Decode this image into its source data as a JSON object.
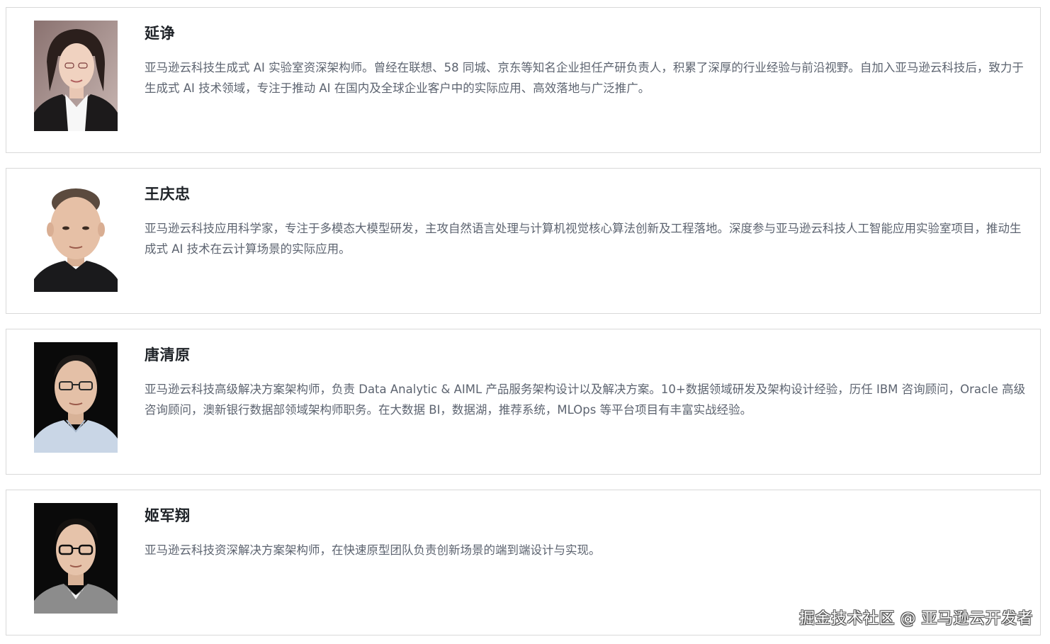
{
  "profiles": [
    {
      "name": "延诤",
      "bio": "亚马逊云科技生成式 AI 实验室资深架构师。曾经在联想、58 同城、京东等知名企业担任产研负责人，积累了深厚的行业经验与前沿视野。自加入亚马逊云科技后，致力于生成式 AI 技术领域，专注于推动 AI 在国内及全球企业客户中的实际应用、高效落地与广泛推广。"
    },
    {
      "name": "王庆忠",
      "bio": "亚马逊云科技应用科学家，专注于多模态大模型研发，主攻自然语言处理与计算机视觉核心算法创新及工程落地。深度参与亚马逊云科技人工智能应用实验室项目，推动生成式 AI 技术在云计算场景的实际应用。"
    },
    {
      "name": "唐清原",
      "bio": "亚马逊云科技高级解决方案架构师，负责 Data Analytic & AIML 产品服务架构设计以及解决方案。10+数据领域研发及架构设计经验，历任 IBM 咨询顾问，Oracle 高级咨询顾问，澳新银行数据部领域架构师职务。在大数据 BI，数据湖，推荐系统，MLOps 等平台项目有丰富实战经验。"
    },
    {
      "name": "姬军翔",
      "bio": "亚马逊云科技资深解决方案架构师，在快速原型团队负责创新场景的端到端设计与实现。"
    }
  ],
  "watermark": "掘金技术社区 @ 亚马逊云开发者"
}
